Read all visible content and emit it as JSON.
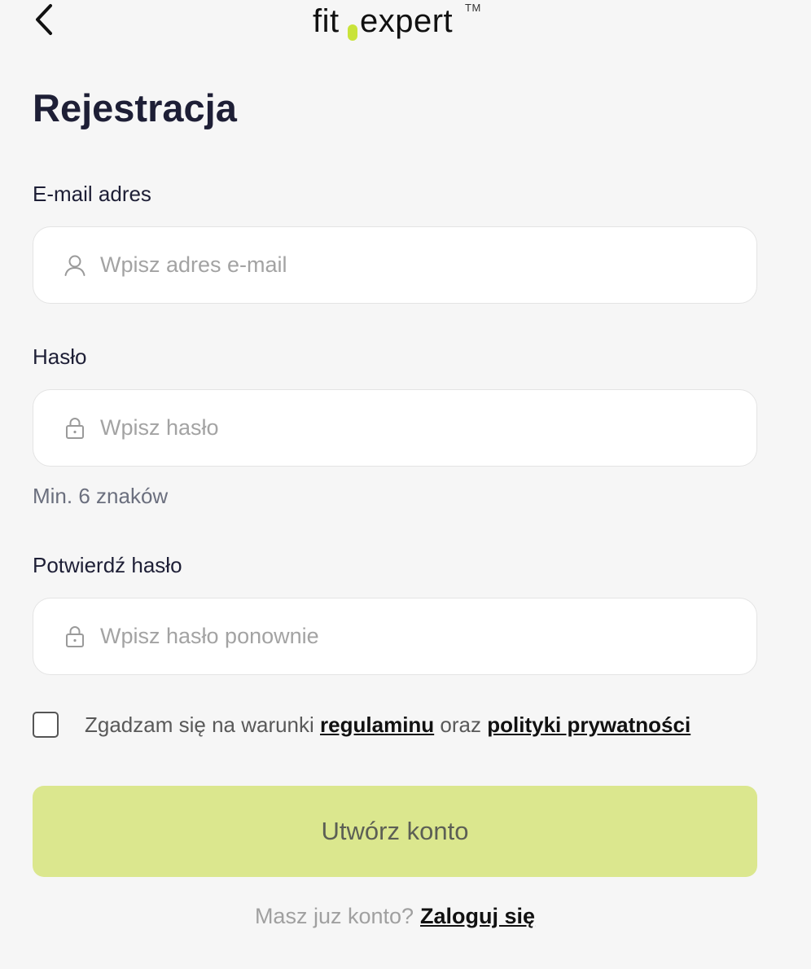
{
  "header": {
    "logo_part1": "fit",
    "logo_part2": "expert",
    "logo_tm": "TM",
    "accent_color": "#c9e33a",
    "back_icon": "chevron-left-icon"
  },
  "title": "Rejestracja",
  "email": {
    "label": "E-mail adres",
    "placeholder": "Wpisz adres e-mail",
    "value": "",
    "icon": "user-icon"
  },
  "password": {
    "label": "Hasło",
    "placeholder": "Wpisz hasło",
    "value": "",
    "icon": "lock-icon",
    "hint": "Min. 6 znaków"
  },
  "confirm_password": {
    "label": "Potwierdź hasło",
    "placeholder": "Wpisz hasło ponownie",
    "value": "",
    "icon": "lock-icon"
  },
  "consent": {
    "checked": false,
    "text_before": "Zgadzam się na warunki",
    "terms_link": "regulaminu",
    "text_middle": "oraz",
    "privacy_link": "polityki prywatności"
  },
  "submit": {
    "label": "Utwórz konto",
    "color": "#dbe78e"
  },
  "login": {
    "prompt": "Masz juz konto?",
    "link": "Zaloguj się"
  }
}
